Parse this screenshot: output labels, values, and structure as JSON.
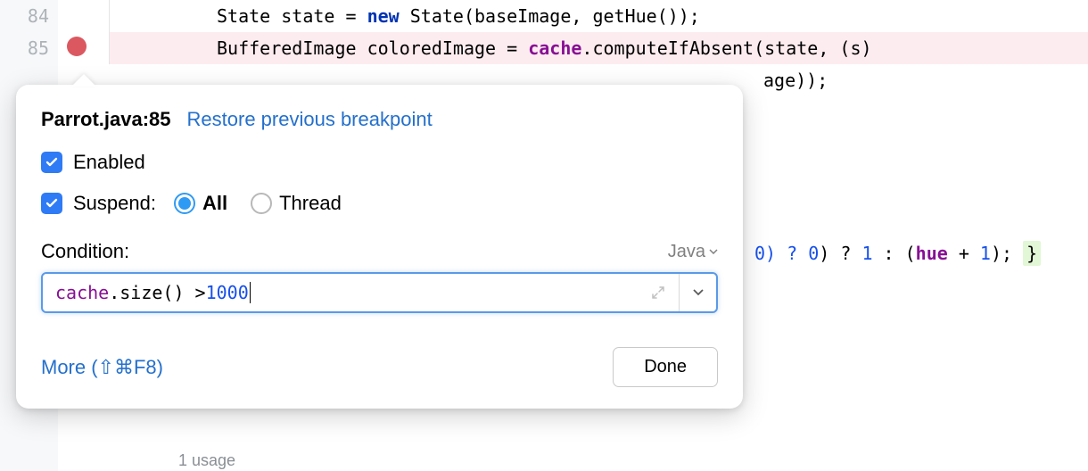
{
  "gutter": {
    "line84": "84",
    "line85": "85"
  },
  "code": {
    "line84": {
      "p1": "State state = ",
      "kw_new": "new",
      "p2": " State(baseImage, getHue());"
    },
    "line85": {
      "p1": "BufferedImage coloredImage = ",
      "field": "cache",
      "p2": ".computeIfAbsent(state, (s)"
    },
    "line86_frag": "age));",
    "line_frag2_a": "0) ? ",
    "line_frag2_num1": "1",
    "line_frag2_b": " : (",
    "line_frag2_hue": "hue",
    "line_frag2_c": " + ",
    "line_frag2_num2": "1",
    "line_frag2_d": "); ",
    "line_frag2_brace": "}"
  },
  "inlay": {
    "usage": "1 usage"
  },
  "popup": {
    "title": "Parrot.java:85",
    "restore_link": "Restore previous breakpoint",
    "enabled_label": "Enabled",
    "suspend_label": "Suspend:",
    "suspend_all": "All",
    "suspend_thread": "Thread",
    "condition_label": "Condition:",
    "language": "Java",
    "more_link": "More (⇧⌘F8)",
    "done_label": "Done"
  },
  "condition": {
    "p1": "cache",
    "p2": ".size() > ",
    "num": "1000"
  }
}
